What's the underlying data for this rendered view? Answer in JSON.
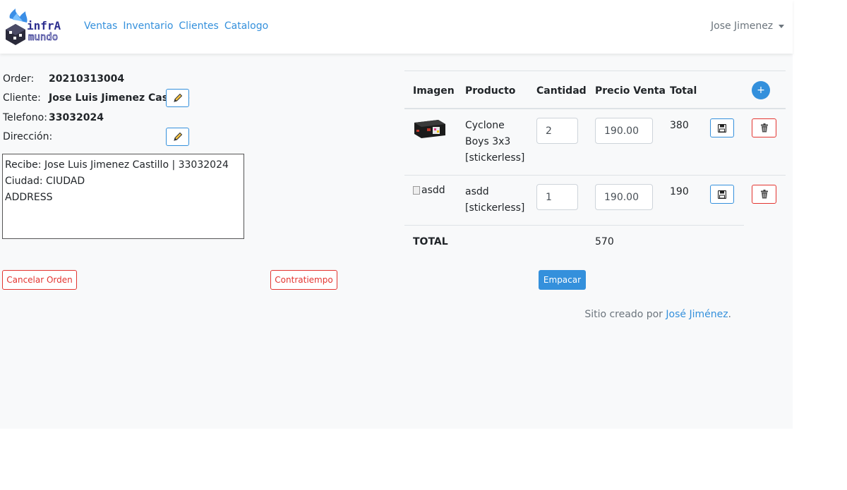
{
  "navbar": {
    "brand": "infrA mundo",
    "links": [
      "Ventas",
      "Inventario",
      "Clientes",
      "Catalogo"
    ],
    "user": "Jose Jimenez"
  },
  "order": {
    "order_label": "Order:",
    "order_value": "20210313004",
    "client_label": "Cliente:",
    "client_value": "Jose Luis Jimenez Castillo",
    "phone_label": "Telefono:",
    "phone_value": "33032024",
    "address_label": "Dirección:",
    "address_text": "Recibe: Jose Luis Jimenez Castillo | 33032024\nCiudad: CIUDAD\nADDRESS"
  },
  "actions": {
    "cancel": "Cancelar Orden",
    "setback": "Contratiempo",
    "pack": "Empacar"
  },
  "table": {
    "headers": [
      "Imagen",
      "Producto",
      "Cantidad",
      "Precio Venta",
      "Total"
    ],
    "add_label": "+",
    "rows": [
      {
        "product_line1": "Cyclone",
        "product_line2": "Boys 3x3",
        "product_line3": "[stickerless]",
        "quantity": "2",
        "price": "190.00",
        "total": "380"
      },
      {
        "image_alt": "asdd",
        "product_line1": "asdd",
        "product_line2": "[stickerless]",
        "quantity": "1",
        "price": "190.00",
        "total": "190"
      }
    ],
    "total_label": "TOTAL",
    "total_value": "570"
  },
  "footer": {
    "text": "Sitio creado por ",
    "author": "José Jiménez",
    "suffix": "."
  },
  "colors": {
    "primary": "#3490dc",
    "danger": "#e3342f",
    "background": "#f8f9fa"
  },
  "icons": [
    "pencil-icon",
    "floppy-disk-icon",
    "trash-can-icon",
    "plus-icon",
    "caret-down-icon",
    "brand-logo"
  ]
}
